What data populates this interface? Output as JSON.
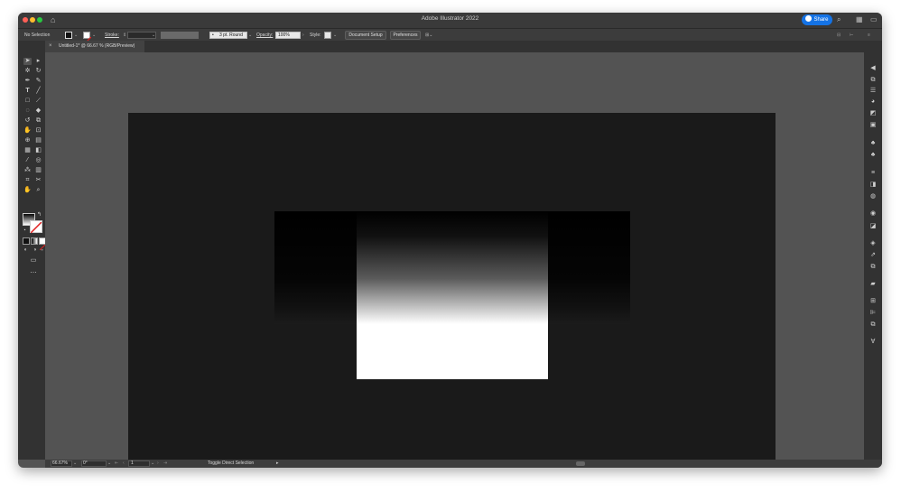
{
  "window": {
    "title": "Adobe Illustrator 2022"
  },
  "titlebar": {
    "traffic_lights": {
      "close": "#ff5f57",
      "minimize": "#febc2e",
      "zoom": "#28c840"
    },
    "home_icon": "home-icon",
    "share_label": "Share",
    "search_icon": "search-icon",
    "arrange_icon": "arrange-documents-icon",
    "workspace_icon": "workspace-switcher-icon"
  },
  "control_bar": {
    "selection_label": "No Selection",
    "stroke_label": "Stroke:",
    "brush_value": "3 pt. Round",
    "opacity_label": "Opacity:",
    "opacity_value": "100%",
    "style_label": "Style:",
    "document_setup_label": "Document Setup",
    "preferences_label": "Preferences"
  },
  "document_tab": {
    "title": "Untitled-1* @ 66.67 % (RGB/Preview)"
  },
  "status_bar": {
    "zoom": "66.67%",
    "rotation": "0°",
    "artboard_number": "1",
    "status_text": "Toggle Direct Selection"
  },
  "colors": {
    "artboard": "#1a1a1a",
    "canvas": "#535353",
    "accent": "#1473e6"
  }
}
